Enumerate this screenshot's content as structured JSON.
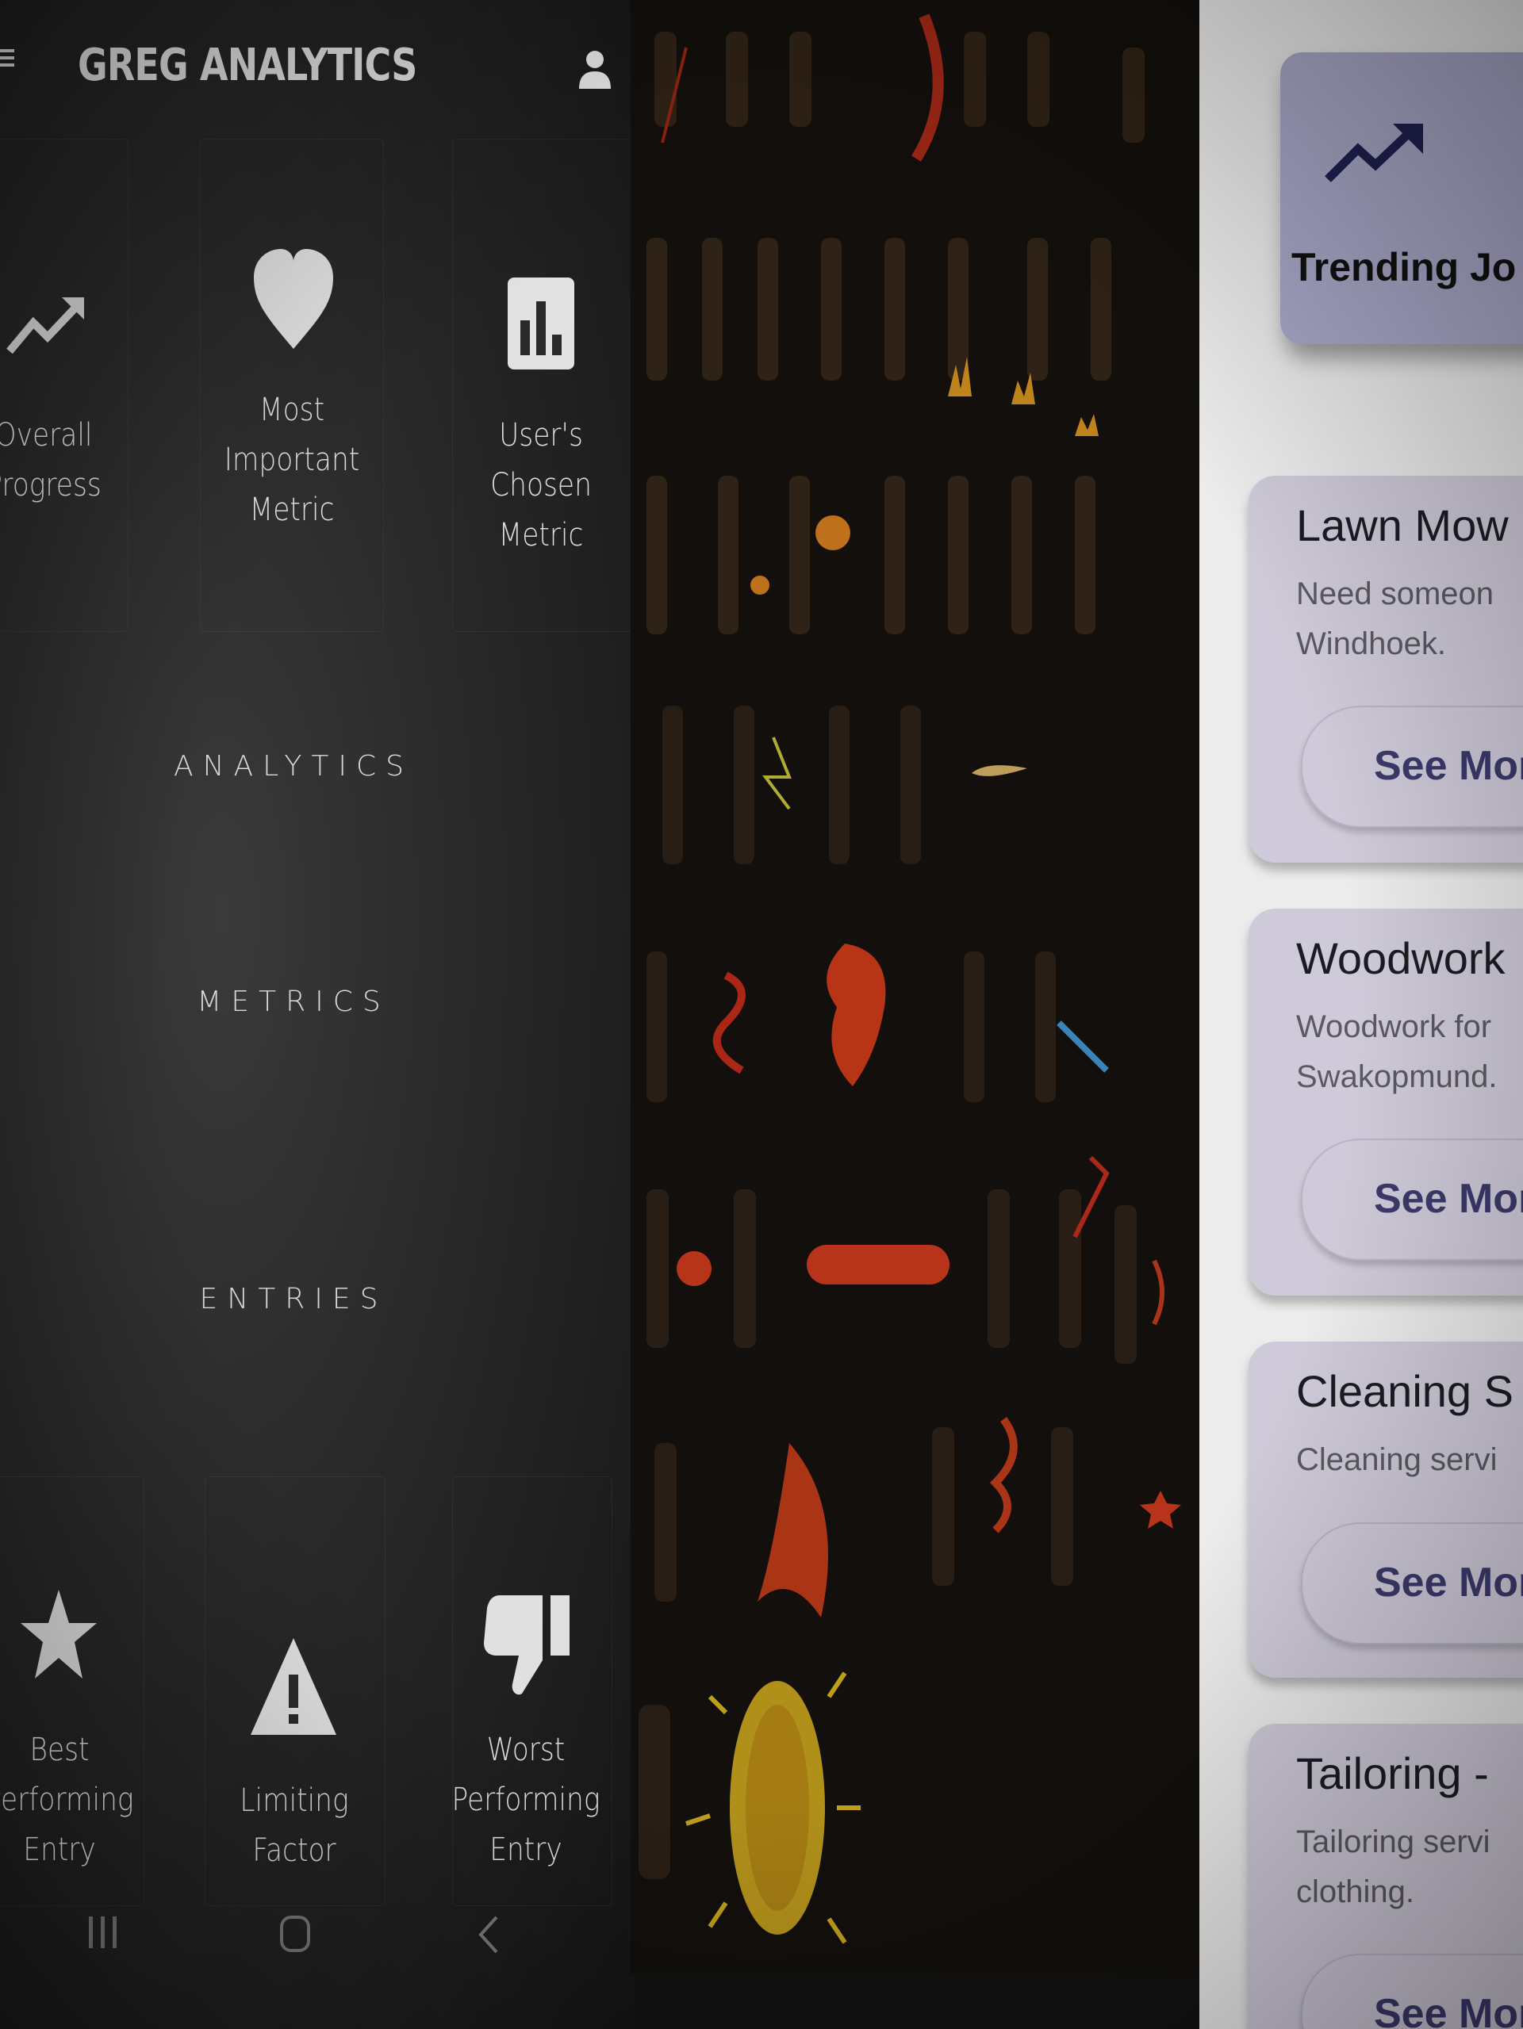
{
  "app": {
    "title": "GREG ANALYTICS",
    "top_tiles": [
      {
        "icon": "trending-up-icon",
        "label_lines": [
          "Overall",
          "Progress"
        ]
      },
      {
        "icon": "heart-icon",
        "label_lines": [
          "Most",
          "Important",
          "Metric"
        ]
      },
      {
        "icon": "bar-chart-icon",
        "label_lines": [
          "User's Chosen",
          "Metric"
        ]
      }
    ],
    "sections": [
      "ANALYTICS",
      "METRICS",
      "ENTRIES"
    ],
    "bottom_tiles": [
      {
        "icon": "star-icon",
        "label_lines": [
          "Best",
          "Performing",
          "Entry"
        ]
      },
      {
        "icon": "warning-icon",
        "label_lines": [
          "Limiting Factor"
        ]
      },
      {
        "icon": "thumbs-down-icon",
        "label_lines": [
          "Worst",
          "Performing",
          "Entry"
        ]
      }
    ],
    "nav_icons": [
      "recent-apps-icon",
      "home-icon",
      "back-icon"
    ]
  },
  "side_panel": {
    "trending_card": {
      "icon": "trending-up-icon",
      "label": "Trending Jo"
    },
    "jobs": [
      {
        "title": "Lawn Mow",
        "description": "Need someon\nWindhoek.",
        "button": "See Mor"
      },
      {
        "title": "Woodwork",
        "description": "Woodwork for\nSwakopmund.",
        "button": "See Mor"
      },
      {
        "title": "Cleaning S",
        "description": "Cleaning servi",
        "button": "See Mor"
      },
      {
        "title": "Tailoring -",
        "description": "Tailoring servi\nclothing.",
        "button": "See Mor"
      }
    ]
  },
  "colors": {
    "app_background": "#2a2a2a",
    "app_text": "#e6e6e6",
    "panel_background": "#ececec",
    "card_background": "#cfcad9",
    "trend_card_background": "#a9a8c8",
    "accent_text": "#3b3a6b"
  }
}
